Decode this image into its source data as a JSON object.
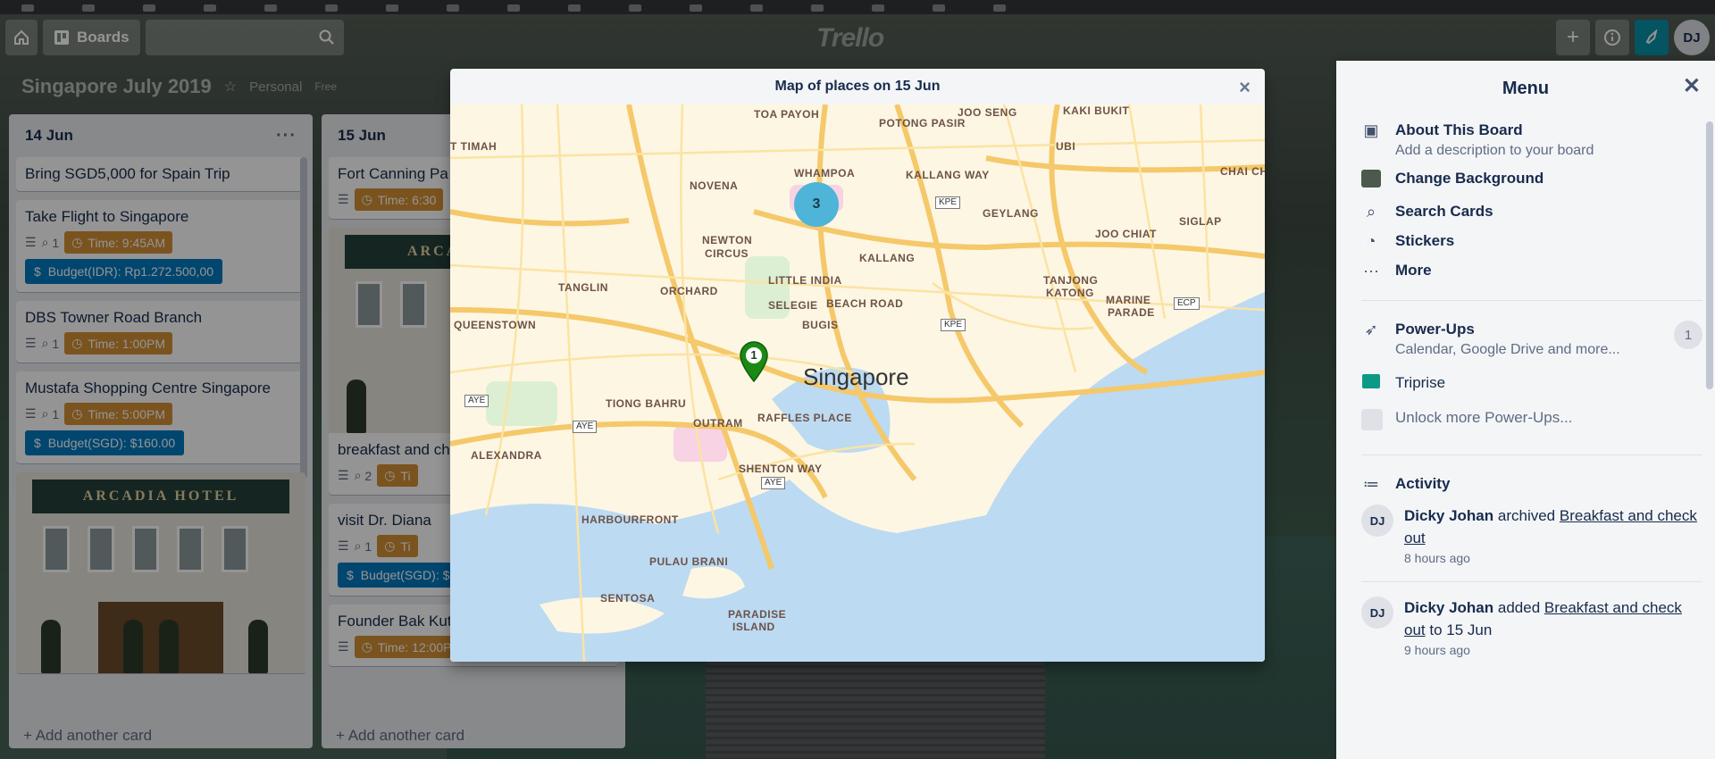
{
  "header": {
    "boards_label": "Boards",
    "logo": "Trello",
    "avatar_initials": "DJ"
  },
  "board": {
    "title": "Singapore July 2019",
    "visibility": "Personal",
    "plan": "Free"
  },
  "lists": [
    {
      "title": "14 Jun",
      "add_card": "+ Add another card",
      "cards": [
        {
          "title": "Bring SGD5,000 for Spain Trip"
        },
        {
          "title": "Take Flight to Singapore",
          "attachments": "1",
          "time": "Time: 9:45AM",
          "budget": "Budget(IDR): Rp1.272.500,00"
        },
        {
          "title": "DBS Towner Road Branch",
          "attachments": "1",
          "time": "Time: 1:00PM"
        },
        {
          "title": "Mustafa Shopping Centre Singapore",
          "attachments": "1",
          "time": "Time: 5:00PM",
          "budget": "Budget(SGD): $160.00"
        },
        {
          "cover_sign": "ARCADIA HOTEL"
        }
      ]
    },
    {
      "title": "15 Jun",
      "add_card": "+ Add another card",
      "cards": [
        {
          "title": "Fort Canning Pa",
          "time": "Time: 6:30"
        },
        {
          "cover_sign": "ARCA"
        },
        {
          "title": "breakfast and ch",
          "attachments": "2",
          "time": "Ti"
        },
        {
          "title": "visit Dr. Diana",
          "attachments": "1",
          "time": "Ti",
          "budget": "Budget(SGD): $"
        },
        {
          "title": "Founder Bak Kut",
          "time": "Time: 12:00PM"
        }
      ]
    }
  ],
  "map_modal": {
    "title": "Map of places on 15 Jun",
    "close": "×",
    "cluster_count": "3",
    "pin_number": "1",
    "labels": {
      "toa_payoh": "TOA PAYOH",
      "potong_pasir": "POTONG PASIR",
      "joo_seng": "JOO SENG",
      "kaki_bukit": "KAKI BUKIT",
      "bukit_timah": "T TIMAH",
      "whampoa": "WHAMPOA",
      "kallang_way": "KALLANG WAY",
      "ubi": "UBI",
      "chai_chee": "CHAI CHEEB",
      "novena": "NOVENA",
      "kpe1": "KPE",
      "geylang": "GEYLANG",
      "newton": "NEWTON",
      "circus": "CIRCUS",
      "joo_chiat": "JOO CHIAT",
      "siglap": "SIGLAP",
      "kallang": "KALLANG",
      "tanglin": "TANGLIN",
      "little_india": "LITTLE INDIA",
      "orchard": "ORCHARD",
      "tanjong": "TANJONG",
      "katong": "KATONG",
      "selegie": "SELEGIE",
      "beach_road": "BEACH ROAD",
      "marine": "MARINE",
      "parade": "PARADE",
      "ecp": "ECP",
      "queenstown": "QUEENSTOWN",
      "bugis": "BUGIS",
      "kpe2": "KPE",
      "singapore": "Singapore",
      "aye1": "AYE",
      "tiong_bahru": "TIONG BAHRU",
      "outram": "OUTRAM",
      "raffles_place": "RAFFLES PLACE",
      "aye2": "AYE",
      "alexandra": "ALEXANDRA",
      "shenton_way": "SHENTON WAY",
      "aye3": "AYE",
      "harbourfront": "HARBOURFRONT",
      "pulau_brani": "PULAU BRANI",
      "sentosa": "SENTOSA",
      "paradise": "PARADISE",
      "island": "ISLAND"
    }
  },
  "menu": {
    "title": "Menu",
    "about_title": "About This Board",
    "about_sub": "Add a description to your board",
    "change_bg": "Change Background",
    "search_cards": "Search Cards",
    "stickers": "Stickers",
    "more": "More",
    "powerups_title": "Power-Ups",
    "powerups_sub": "Calendar, Google Drive and more...",
    "powerups_count": "1",
    "triprise": "Triprise",
    "unlock": "Unlock more Power-Ups...",
    "activity_title": "Activity",
    "activity": [
      {
        "initials": "DJ",
        "user": "Dicky Johan",
        "verb": " archived ",
        "link": "Breakfast and check out",
        "rest": "",
        "ago": "8 hours ago"
      },
      {
        "initials": "DJ",
        "user": "Dicky Johan",
        "verb": " added ",
        "link": "Breakfast and check out",
        "rest": " to 15 Jun",
        "ago": "9 hours ago"
      }
    ]
  }
}
